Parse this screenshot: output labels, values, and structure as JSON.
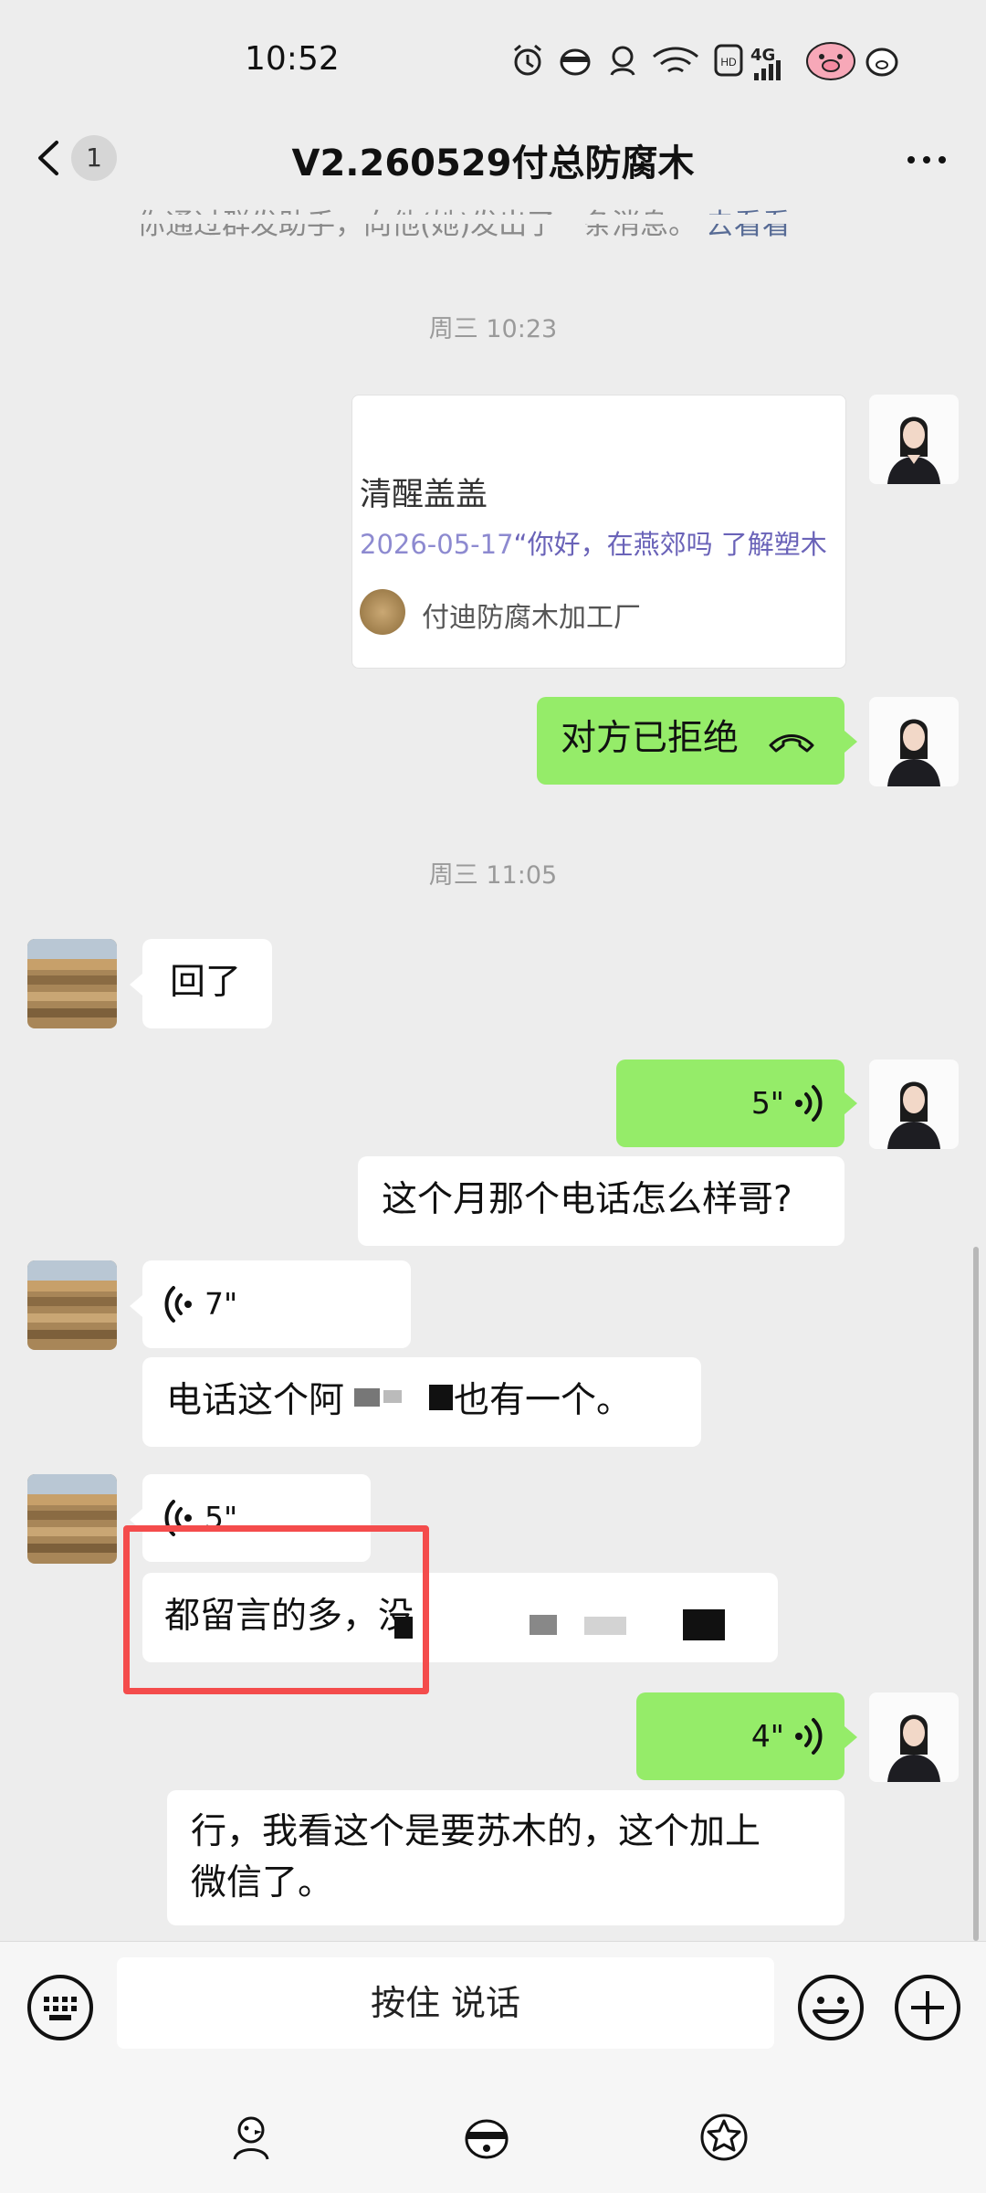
{
  "status_bar": {
    "time": "10:52",
    "network": "4G"
  },
  "header": {
    "unread_count": "1",
    "title": "V2.260529付总防腐木"
  },
  "system_message": {
    "text": "你通过群发助手，向他(她)发出了一条消息。",
    "link": "去看看"
  },
  "messages": {
    "time_1": "周三 10:23",
    "card": {
      "title": "清醒盖盖",
      "date": "2026-05-17",
      "snippet": "“你好，在燕郊吗 了解塑木",
      "source": "付迪防腐木加工厂"
    },
    "call_status": "对方已拒绝",
    "time_2": "周三 11:05",
    "reply_1": "回了",
    "voice_1": "5\"",
    "question": "这个月那个电话怎么样哥?",
    "voice_2": "7\"",
    "reply_2_pre": "电话这个阿",
    "reply_2_post": "也有一个。",
    "voice_3": "5\"",
    "reply_3_pre": "都留言的多，没",
    "voice_4": "4\"",
    "final_line_1": "行，我看这个是要苏木的，这个加上",
    "final_line_2": "微信了。"
  },
  "input_bar": {
    "voice_label": "按住 说话"
  },
  "icons": {
    "back": "chevron-left-icon",
    "more": "more-dots-icon",
    "keyboard": "keyboard-icon",
    "emoji": "emoji-icon",
    "plus": "plus-icon",
    "call": "hang-up-icon",
    "voice": "voice-wave-icon"
  },
  "colors": {
    "background": "#ededed",
    "sent_bubble": "#95ec69",
    "received_bubble": "#ffffff",
    "link": "#576b95",
    "highlight": "#f44c4c"
  }
}
